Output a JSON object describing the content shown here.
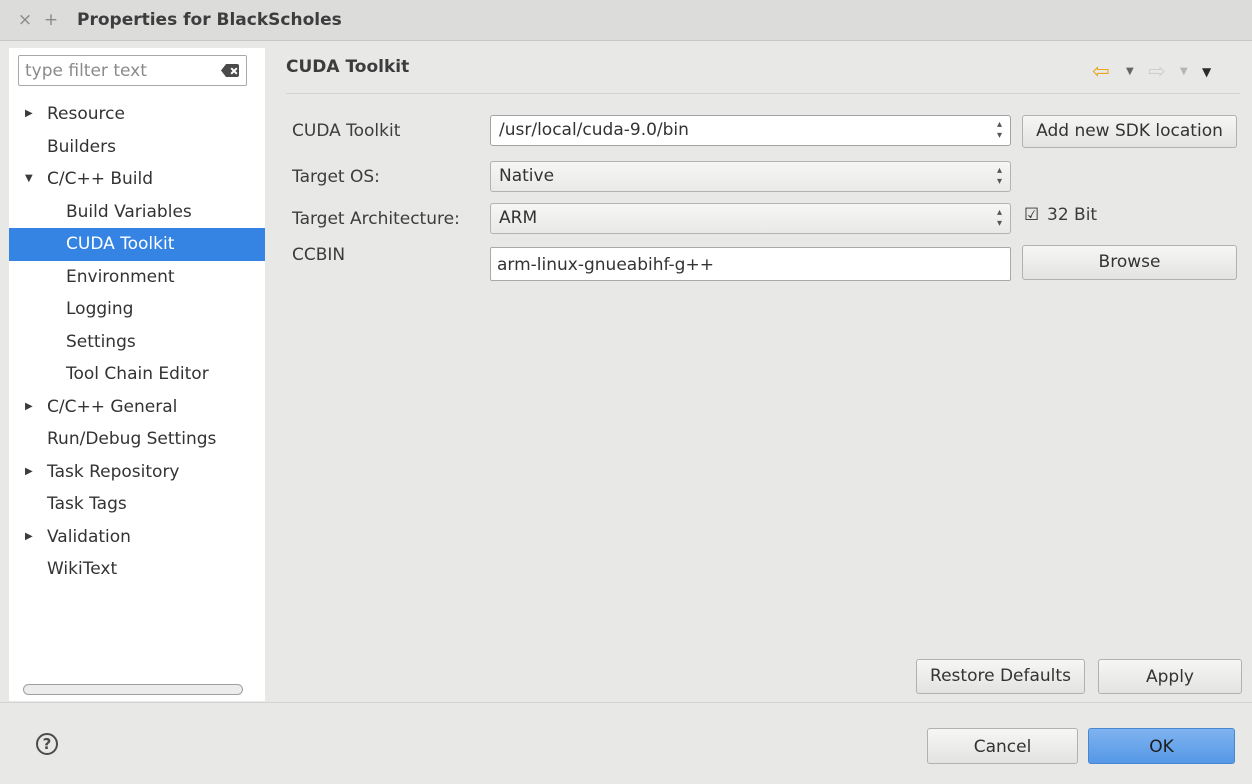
{
  "window": {
    "title": "Properties for BlackScholes",
    "close_glyph": "×",
    "plus_glyph": "+"
  },
  "filter": {
    "placeholder": "type filter text"
  },
  "tree": {
    "items": [
      {
        "label": "Resource",
        "level": 0,
        "expandable": true,
        "expanded": false
      },
      {
        "label": "Builders",
        "level": 0,
        "expandable": false
      },
      {
        "label": "C/C++ Build",
        "level": 0,
        "expandable": true,
        "expanded": true
      },
      {
        "label": "Build Variables",
        "level": 1
      },
      {
        "label": "CUDA Toolkit",
        "level": 1,
        "selected": true
      },
      {
        "label": "Environment",
        "level": 1
      },
      {
        "label": "Logging",
        "level": 1
      },
      {
        "label": "Settings",
        "level": 1
      },
      {
        "label": "Tool Chain Editor",
        "level": 1
      },
      {
        "label": "C/C++ General",
        "level": 0,
        "expandable": true,
        "expanded": false
      },
      {
        "label": "Run/Debug Settings",
        "level": 0,
        "expandable": false
      },
      {
        "label": "Task Repository",
        "level": 0,
        "expandable": true,
        "expanded": false
      },
      {
        "label": "Task Tags",
        "level": 0,
        "expandable": false
      },
      {
        "label": "Validation",
        "level": 0,
        "expandable": true,
        "expanded": false
      },
      {
        "label": "WikiText",
        "level": 0,
        "expandable": false
      }
    ]
  },
  "page": {
    "title": "CUDA Toolkit",
    "cuda_toolkit": {
      "label": "CUDA Toolkit",
      "value": "/usr/local/cuda-9.0/bin"
    },
    "add_sdk_button": "Add new SDK location",
    "target_os": {
      "label": "Target OS:",
      "value": "Native"
    },
    "target_arch": {
      "label": "Target Architecture:",
      "value": "ARM"
    },
    "bit32": {
      "label": "32 Bit",
      "checked": true
    },
    "ccbin": {
      "label": "CCBIN",
      "value": "arm-linux-gnueabihf-g++"
    },
    "browse_button": "Browse",
    "restore_defaults_button": "Restore Defaults",
    "apply_button": "Apply"
  },
  "footer": {
    "help_glyph": "?",
    "cancel_button": "Cancel",
    "ok_button": "OK"
  },
  "colors": {
    "selection": "#3584e4",
    "primary_button": "#5598e6",
    "back_arrow": "#e7a520"
  }
}
